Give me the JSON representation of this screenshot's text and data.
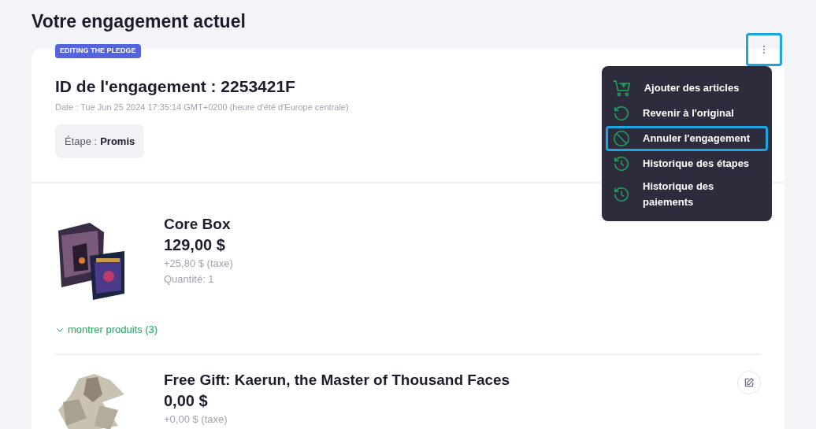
{
  "page_title": "Votre engagement actuel",
  "pledge": {
    "badge": "EDITING THE PLEDGE",
    "id_title": "ID de l'engagement : 2253421F",
    "date": "Date : Tue Jun 25 2024 17:35:14 GMT+0200 (heure d'été d'Europe centrale)",
    "stage_label": "Étape :",
    "stage_value": "Promis"
  },
  "menu": {
    "open": true,
    "items": [
      {
        "kind": "cart",
        "label": "Ajouter des articles",
        "selected": false
      },
      {
        "kind": "undo",
        "label": "Revenir à l'original",
        "selected": false
      },
      {
        "kind": "cancel",
        "label": "Annuler l'engagement",
        "selected": true
      },
      {
        "kind": "history",
        "label": "Historique des étapes",
        "selected": false
      },
      {
        "kind": "history",
        "label": "Historique des paiements",
        "selected": false
      }
    ]
  },
  "products": [
    {
      "kind": "box",
      "name": "Core Box",
      "price": "129,00 $",
      "tax": "+25,80 $ (taxe)",
      "quantity": "Quantité: 1",
      "show_products": "montrer produits (3)"
    },
    {
      "kind": "figure",
      "name": "Free Gift: Kaerun, the Master of Thousand Faces",
      "price": "0,00 $",
      "tax": "+0,00 $ (taxe)"
    }
  ]
}
